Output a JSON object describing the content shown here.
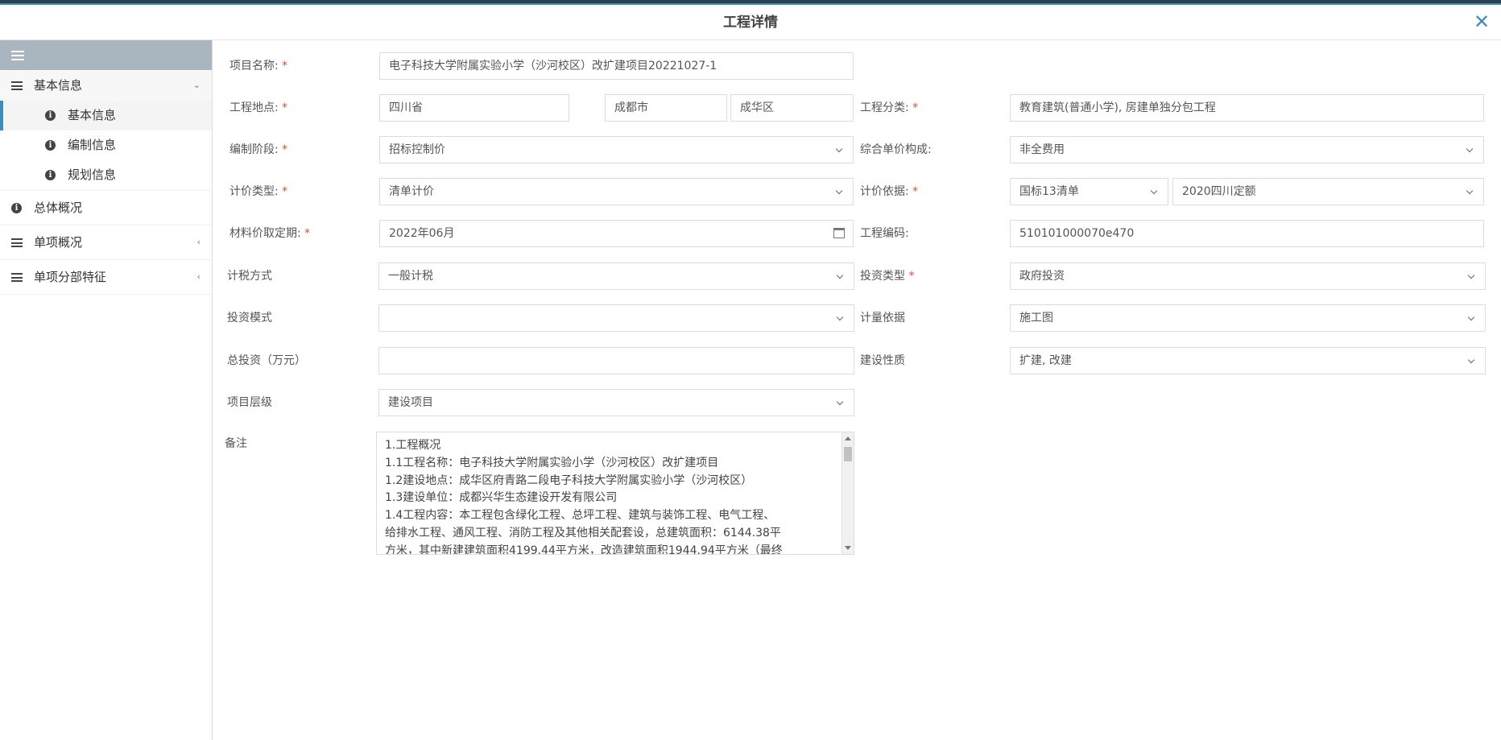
{
  "modal": {
    "title": "工程详情"
  },
  "sidebar": {
    "groups": [
      {
        "label": "基本信息",
        "children": [
          "基本信息",
          "编制信息",
          "规划信息"
        ]
      },
      {
        "label": "总体概况"
      },
      {
        "label": "单项概况"
      },
      {
        "label": "单项分部特征"
      }
    ]
  },
  "form": {
    "project_name": {
      "label": "项目名称:",
      "value": "电子科技大学附属实验小学（沙河校区）改扩建项目20221027-1"
    },
    "location": {
      "label": "工程地点:",
      "province": "四川省",
      "city": "成都市",
      "district": "成华区"
    },
    "category": {
      "label": "工程分类:",
      "value": "教育建筑(普通小学), 房建单独分包工程"
    },
    "stage": {
      "label": "编制阶段:",
      "value": "招标控制价"
    },
    "unit_price": {
      "label": "综合单价构成:",
      "value": "非全费用"
    },
    "pricing_type": {
      "label": "计价类型:",
      "value": "清单计价"
    },
    "pricing_basis": {
      "label": "计价依据:",
      "value1": "国标13清单",
      "value2": "2020四川定额"
    },
    "material_date": {
      "label": "材料价取定期:",
      "value": "2022年06月"
    },
    "project_code": {
      "label": "工程编码:",
      "value": "510101000070e470"
    },
    "tax_method": {
      "label": "计税方式",
      "value": "一般计税"
    },
    "invest_type": {
      "label": "投资类型",
      "value": "政府投资"
    },
    "invest_mode": {
      "label": "投资模式",
      "value": ""
    },
    "measure_basis": {
      "label": "计量依据",
      "value": "施工图"
    },
    "total_invest": {
      "label": "总投资（万元）",
      "value": ""
    },
    "build_nature": {
      "label": "建设性质",
      "value": "扩建, 改建"
    },
    "level": {
      "label": "项目层级",
      "value": "建设项目"
    },
    "remark": {
      "label": "备注",
      "lines": [
        "1.工程概况",
        "1.1工程名称：电子科技大学附属实验小学（沙河校区）改扩建项目",
        "1.2建设地点：成华区府青路二段电子科技大学附属实验小学（沙河校区）",
        "1.3建设单位：成都兴华生态建设开发有限公司",
        "1.4工程内容：本工程包含绿化工程、总坪工程、建筑与装饰工程、电气工程、",
        "给排水工程、通风工程、消防工程及其他相关配套设，总建筑面积：6144.38平",
        "方米，其中新建建筑面积4199.44平方米，改造建筑面积1944.94平方米（最终"
      ]
    }
  }
}
